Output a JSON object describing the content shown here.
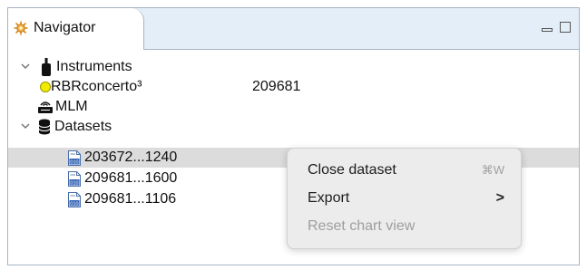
{
  "view": {
    "tab_title": "Navigator"
  },
  "tree": {
    "instruments_label": "Instruments",
    "instrument_name": "RBRconcerto³",
    "instrument_serial": "209681",
    "mlm_label": "MLM",
    "datasets_label": "Datasets",
    "datasets": [
      "203672...1240",
      "209681...1600",
      "209681...1106"
    ]
  },
  "context_menu": {
    "close_label": "Close dataset",
    "close_shortcut": "⌘W",
    "export_label": "Export",
    "export_arrow": ">",
    "reset_label": "Reset chart view"
  },
  "colors": {
    "status_dot": "#f2ea00",
    "tab_bar": "#e4eef9",
    "selection": "#dcdcdc"
  }
}
